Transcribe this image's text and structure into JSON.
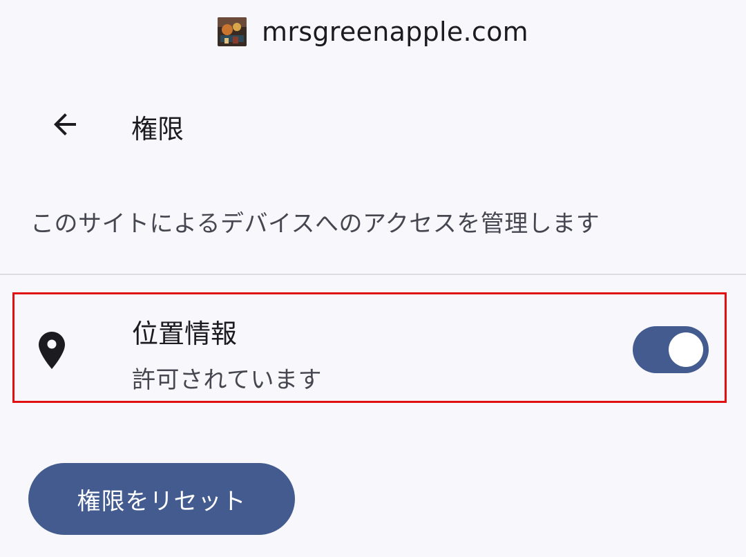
{
  "site": {
    "favicon_icon": "site-favicon-artwork",
    "domain": "mrsgreenapple.com"
  },
  "app_bar": {
    "back_icon": "arrow-back-icon",
    "title": "権限"
  },
  "description": "このサイトによるデバイスへのアクセスを管理します",
  "permissions": [
    {
      "icon": "location-pin-icon",
      "title": "位置情報",
      "status": "許可されています",
      "enabled": true
    }
  ],
  "reset_button": {
    "label": "権限をリセット"
  },
  "colors": {
    "background": "#f8f7fc",
    "accent": "#435b8f",
    "highlight_border": "#e01010",
    "divider": "#dcdce0"
  }
}
